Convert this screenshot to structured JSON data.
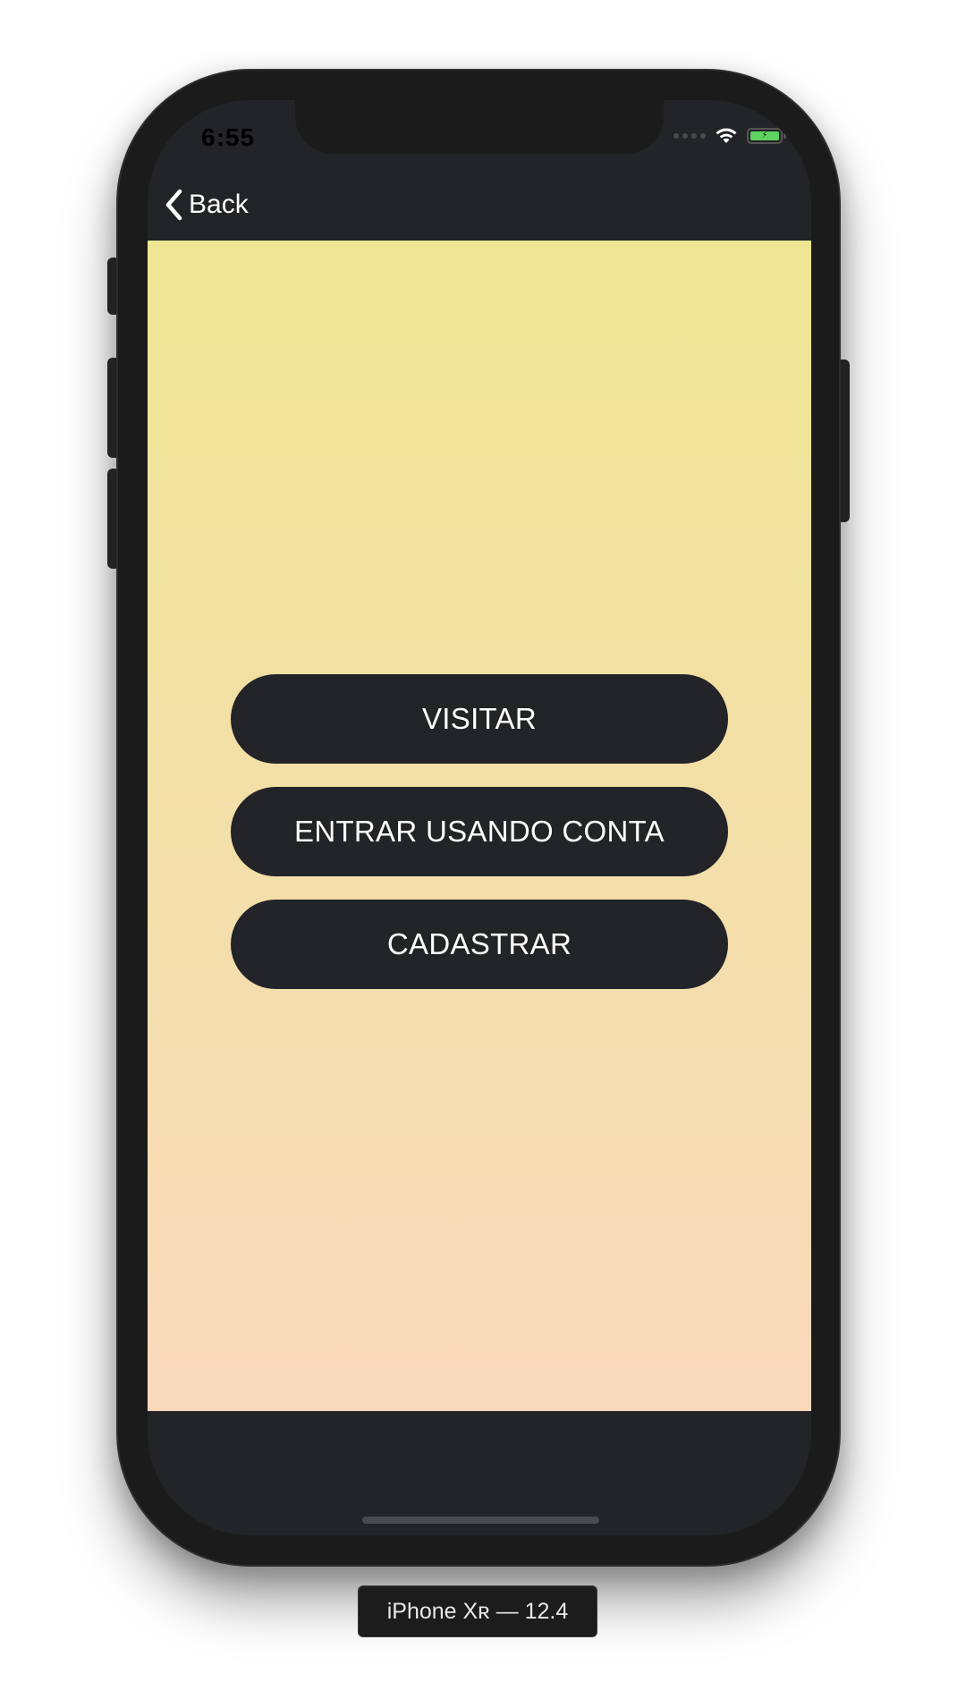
{
  "status_bar": {
    "time": "6:55",
    "icons": [
      "cellular-signal-icon",
      "wifi-icon",
      "battery-charging-icon"
    ],
    "battery_color": "#5fd35f"
  },
  "nav": {
    "back_label": "Back",
    "back_icon": "chevron-left-icon"
  },
  "content": {
    "gradient_top": "#ede593",
    "gradient_bottom": "#f8d8bb",
    "buttons": [
      {
        "label": "VISITAR"
      },
      {
        "label": "ENTRAR USANDO CONTA"
      },
      {
        "label": "CADASTRAR"
      }
    ],
    "button_color": "#232428"
  },
  "simulator": {
    "device_label": "iPhone Xʀ — 12.4"
  }
}
